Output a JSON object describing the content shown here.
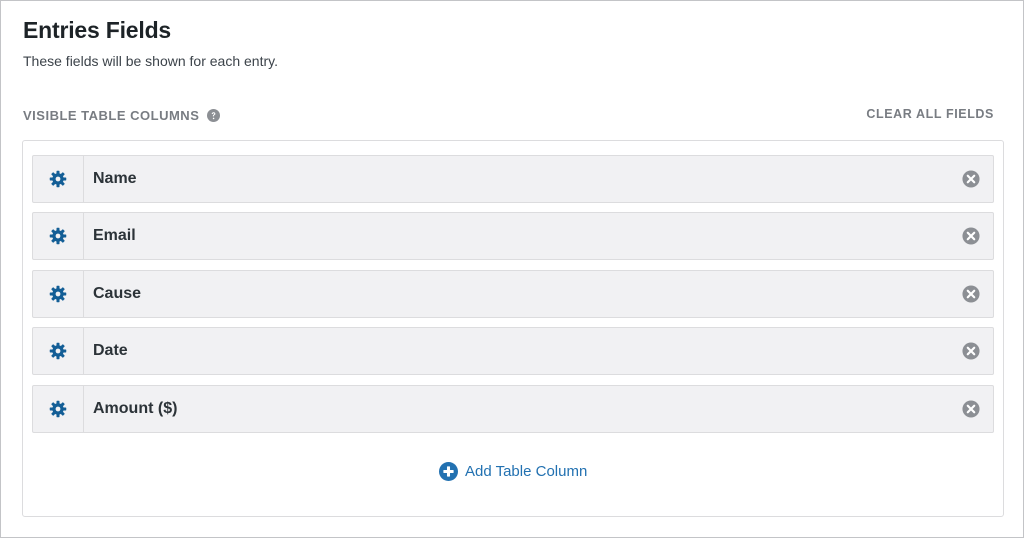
{
  "header": {
    "title": "Entries Fields",
    "subtitle": "These fields will be shown for each entry."
  },
  "section": {
    "label": "VISIBLE TABLE COLUMNS",
    "help_icon": "help-circle-icon",
    "clear_all_label": "CLEAR ALL FIELDS"
  },
  "fields": [
    {
      "label": "Name"
    },
    {
      "label": "Email"
    },
    {
      "label": "Cause"
    },
    {
      "label": "Date"
    },
    {
      "label": "Amount ($)"
    }
  ],
  "add_column": {
    "label": "Add Table Column",
    "icon": "plus-circle-icon"
  },
  "colors": {
    "accent": "#2271b1",
    "gear": "#135e96",
    "muted": "#787c82",
    "remove_icon": "#8c8f94",
    "row_bg": "#f1f1f3"
  }
}
